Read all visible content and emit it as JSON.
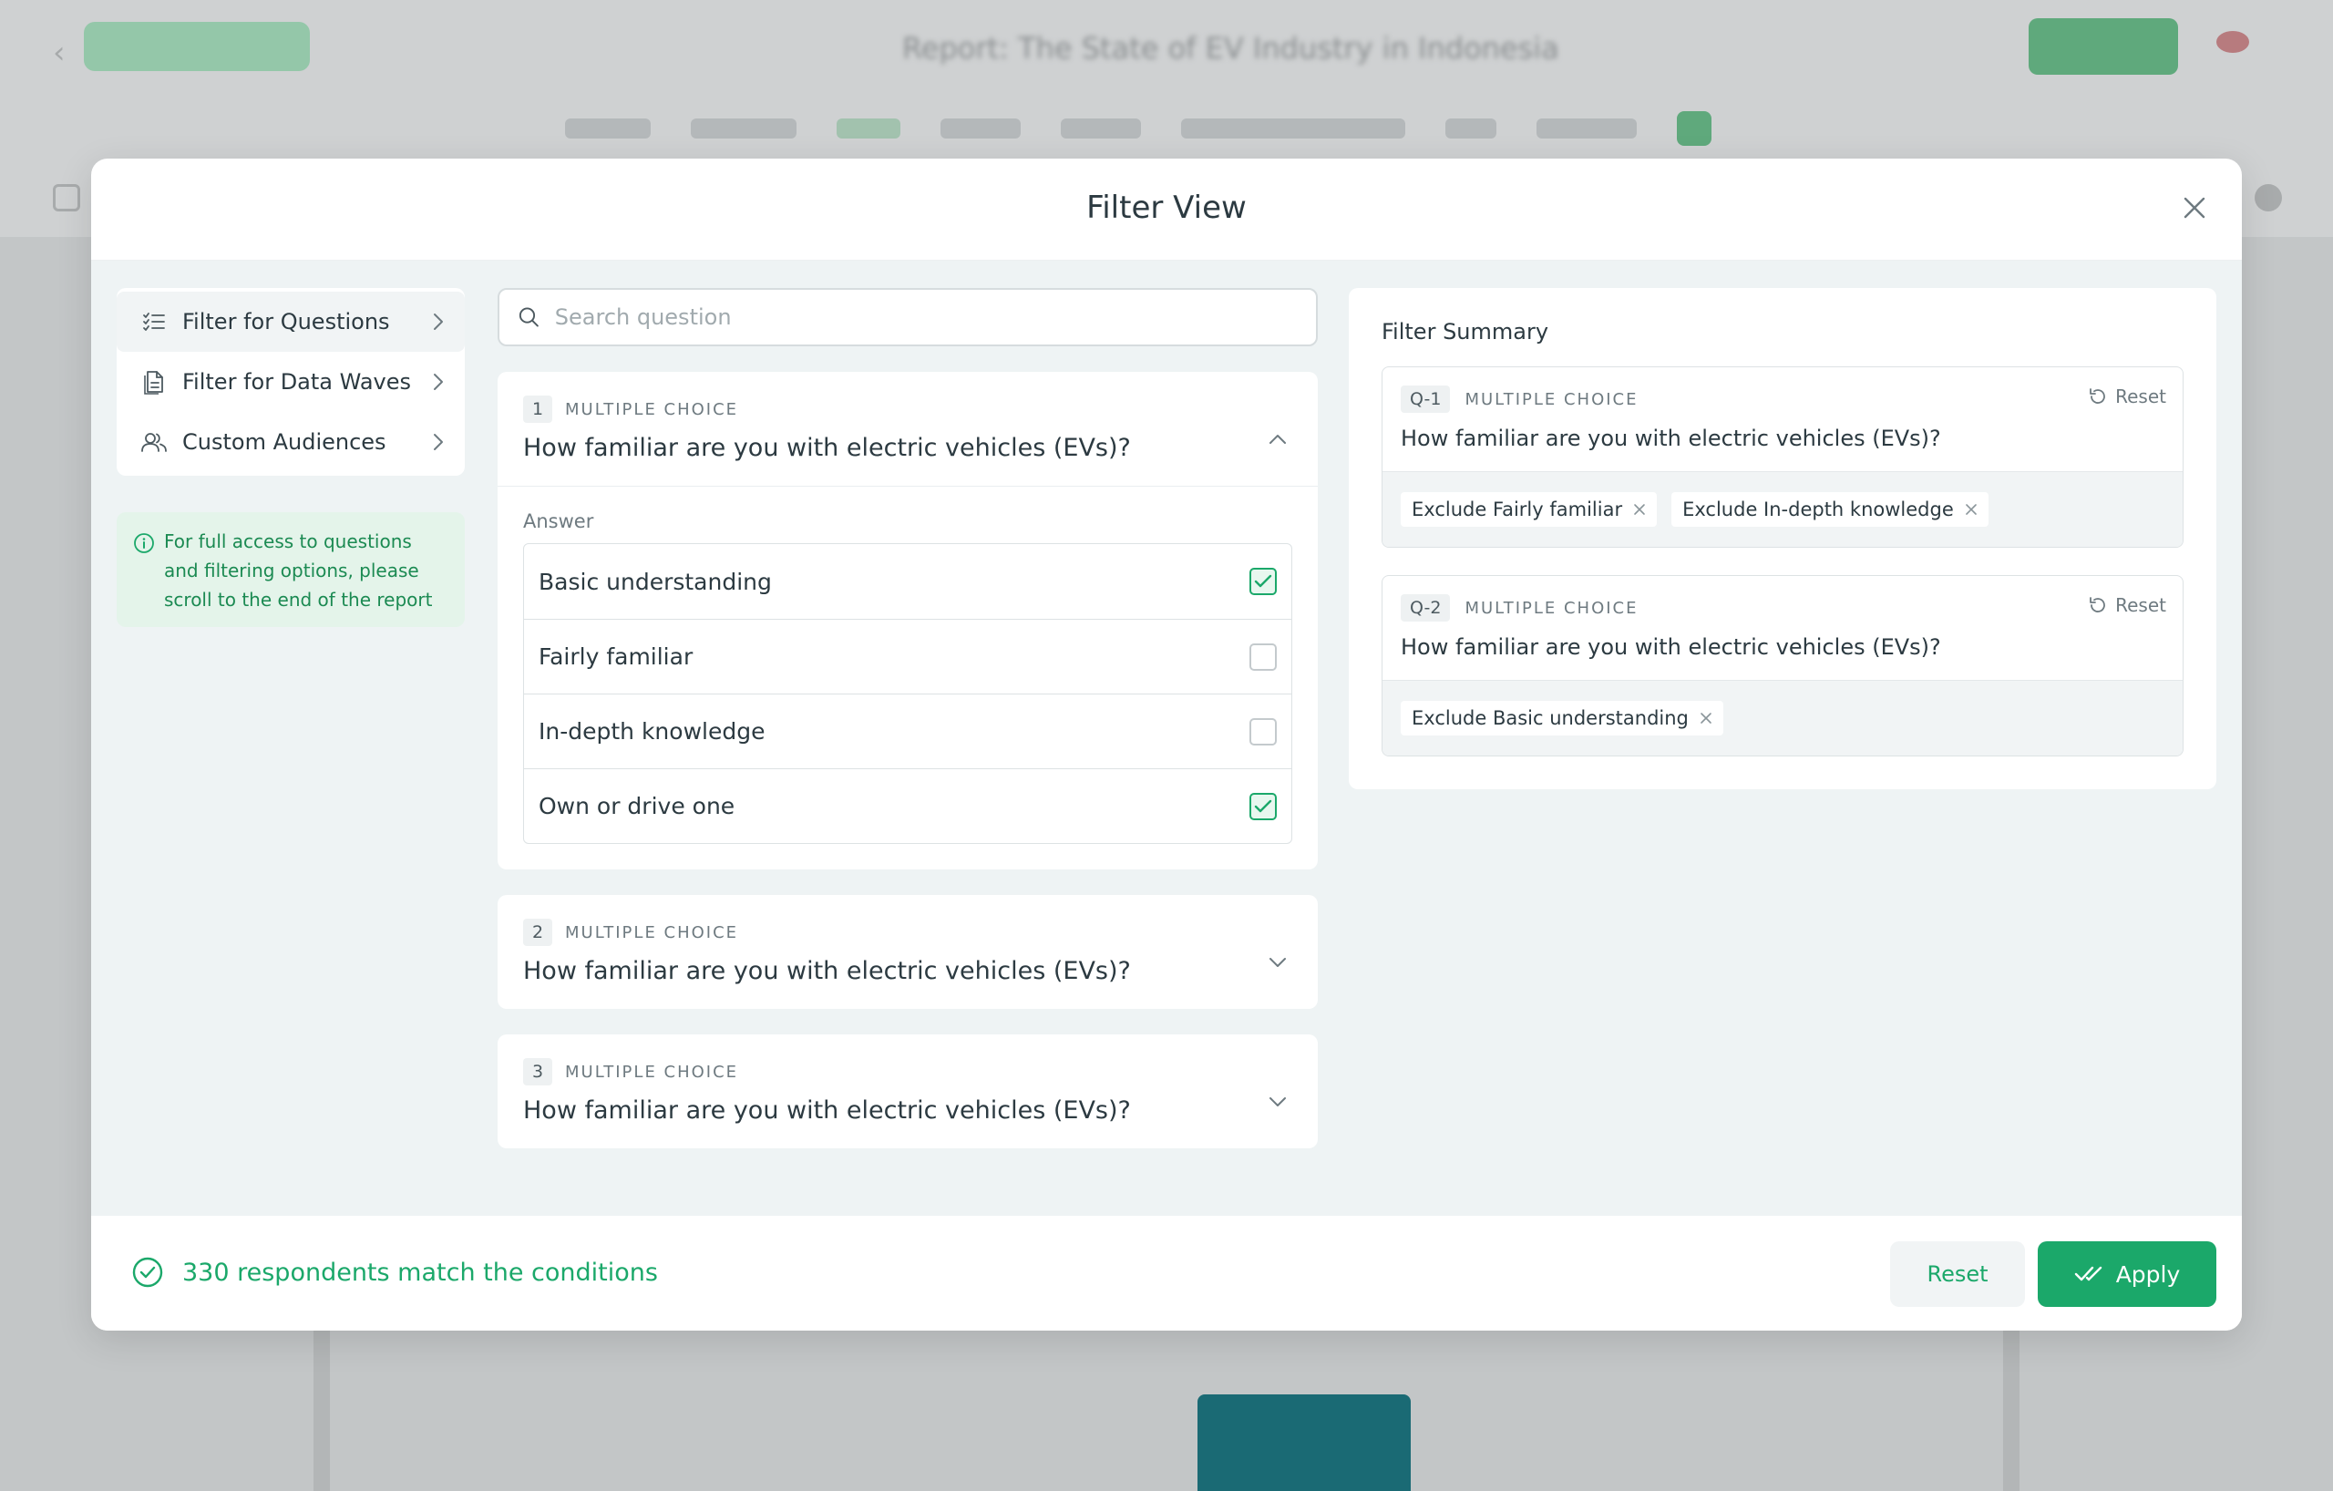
{
  "background": {
    "title": "Report: The State of EV Industry in Indonesia"
  },
  "modal": {
    "title": "Filter View"
  },
  "nav": {
    "items": [
      {
        "label": "Filter for Questions",
        "icon": "checklist-icon",
        "active": true
      },
      {
        "label": "Filter for Data Waves",
        "icon": "document-icon",
        "active": false
      },
      {
        "label": "Custom Audiences",
        "icon": "users-icon",
        "active": false
      }
    ],
    "info": "For full access to questions and filtering options, please scroll to the end of the report"
  },
  "search": {
    "placeholder": "Search question"
  },
  "questions": [
    {
      "number": "1",
      "type": "MULTIPLE CHOICE",
      "text": "How familiar are you with electric vehicles (EVs)?",
      "expanded": true,
      "answer_label": "Answer",
      "answers": [
        {
          "label": "Basic understanding",
          "checked": true
        },
        {
          "label": "Fairly familiar",
          "checked": false
        },
        {
          "label": "In-depth knowledge",
          "checked": false
        },
        {
          "label": "Own or drive one",
          "checked": true
        }
      ]
    },
    {
      "number": "2",
      "type": "MULTIPLE CHOICE",
      "text": "How familiar are you with electric vehicles (EVs)?",
      "expanded": false
    },
    {
      "number": "3",
      "type": "MULTIPLE CHOICE",
      "text": "How familiar are you with electric vehicles (EVs)?",
      "expanded": false
    }
  ],
  "summary": {
    "title": "Filter Summary",
    "reset_label": "Reset",
    "cards": [
      {
        "qnum": "Q-1",
        "type": "MULTIPLE CHOICE",
        "question": "How familiar are you with electric vehicles (EVs)?",
        "chips": [
          "Exclude Fairly familiar",
          "Exclude In-depth knowledge"
        ]
      },
      {
        "qnum": "Q-2",
        "type": "MULTIPLE CHOICE",
        "question": "How familiar are you with electric vehicles (EVs)?",
        "chips": [
          "Exclude Basic understanding"
        ]
      }
    ]
  },
  "footer": {
    "match_text": "330 respondents match the conditions",
    "reset_label": "Reset",
    "apply_label": "Apply"
  },
  "colors": {
    "accent": "#1ba86a",
    "text": "#2c3a41",
    "muted": "#6e7a80"
  }
}
